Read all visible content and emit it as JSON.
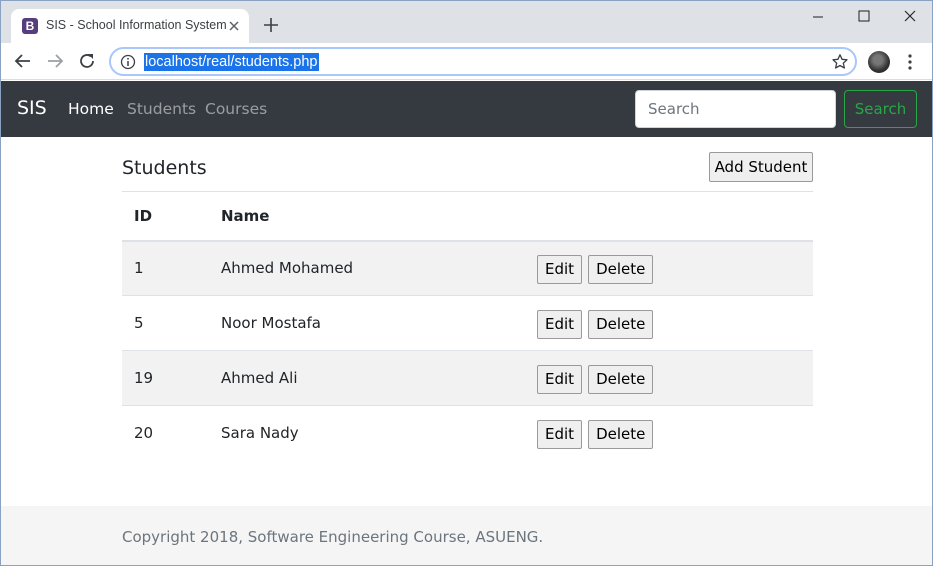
{
  "browser": {
    "tab_favicon_letter": "B",
    "tab_title": "SIS - School Information System",
    "url": "localhost/real/students.php"
  },
  "navbar": {
    "brand": "SIS",
    "links": [
      {
        "label": "Home",
        "active": true
      },
      {
        "label": "Students",
        "active": false
      },
      {
        "label": "Courses",
        "active": false
      }
    ],
    "search_placeholder": "Search",
    "search_button": "Search"
  },
  "page": {
    "title": "Students",
    "add_button": "Add Student"
  },
  "table": {
    "headers": [
      "ID",
      "Name"
    ],
    "rows": [
      {
        "id": "1",
        "name": "Ahmed Mohamed",
        "edit": "Edit",
        "delete": "Delete"
      },
      {
        "id": "5",
        "name": "Noor Mostafa",
        "edit": "Edit",
        "delete": "Delete"
      },
      {
        "id": "19",
        "name": "Ahmed Ali",
        "edit": "Edit",
        "delete": "Delete"
      },
      {
        "id": "20",
        "name": "Sara Nady",
        "edit": "Edit",
        "delete": "Delete"
      }
    ]
  },
  "footer": {
    "text": "Copyright 2018, Software Engineering Course, ASUENG."
  },
  "colors": {
    "navbar_bg": "#343a40",
    "search_green": "#28a745",
    "bootstrap_purple": "#563d7c",
    "url_highlight": "#1a73e8"
  },
  "icons": [
    "close-icon",
    "plus-icon",
    "minimize-icon",
    "maximize-icon",
    "back-arrow-icon",
    "forward-arrow-icon",
    "reload-icon",
    "info-icon",
    "star-icon",
    "profile-avatar",
    "kebab-menu-icon"
  ]
}
